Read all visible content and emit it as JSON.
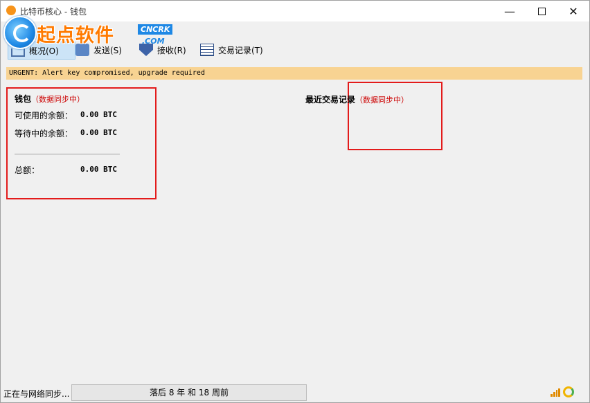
{
  "window": {
    "title": "比特币核心 - 钱包"
  },
  "watermark": {
    "text": "起点软件",
    "badge": "CNCRK",
    "com": ".COM"
  },
  "toolbar": {
    "overview": "概况(O)",
    "send": "发送(S)",
    "receive": "接收(R)",
    "transactions": "交易记录(T)"
  },
  "alert": {
    "text": "URGENT: Alert key compromised, upgrade required"
  },
  "wallet": {
    "title": "钱包",
    "sync": "（数据同步中）",
    "available_label": "可使用的余额：",
    "available_value": "0.00 BTC",
    "pending_label": "等待中的余额：",
    "pending_value": "0.00 BTC",
    "total_label": "总额：",
    "total_value": "0.00 BTC"
  },
  "recent": {
    "title": "最近交易记录",
    "sync": "（数据同步中）"
  },
  "status": {
    "text": "正在与网络同步...",
    "progress_label": "落后 8 年 和 18 周前",
    "progress_fraction": 0.0
  },
  "colors": {
    "alert_bg": "#f8d392",
    "highlight_red": "#e31b1b",
    "sync_red": "#cc0000",
    "toolbar_selected": "#cce4f7"
  }
}
